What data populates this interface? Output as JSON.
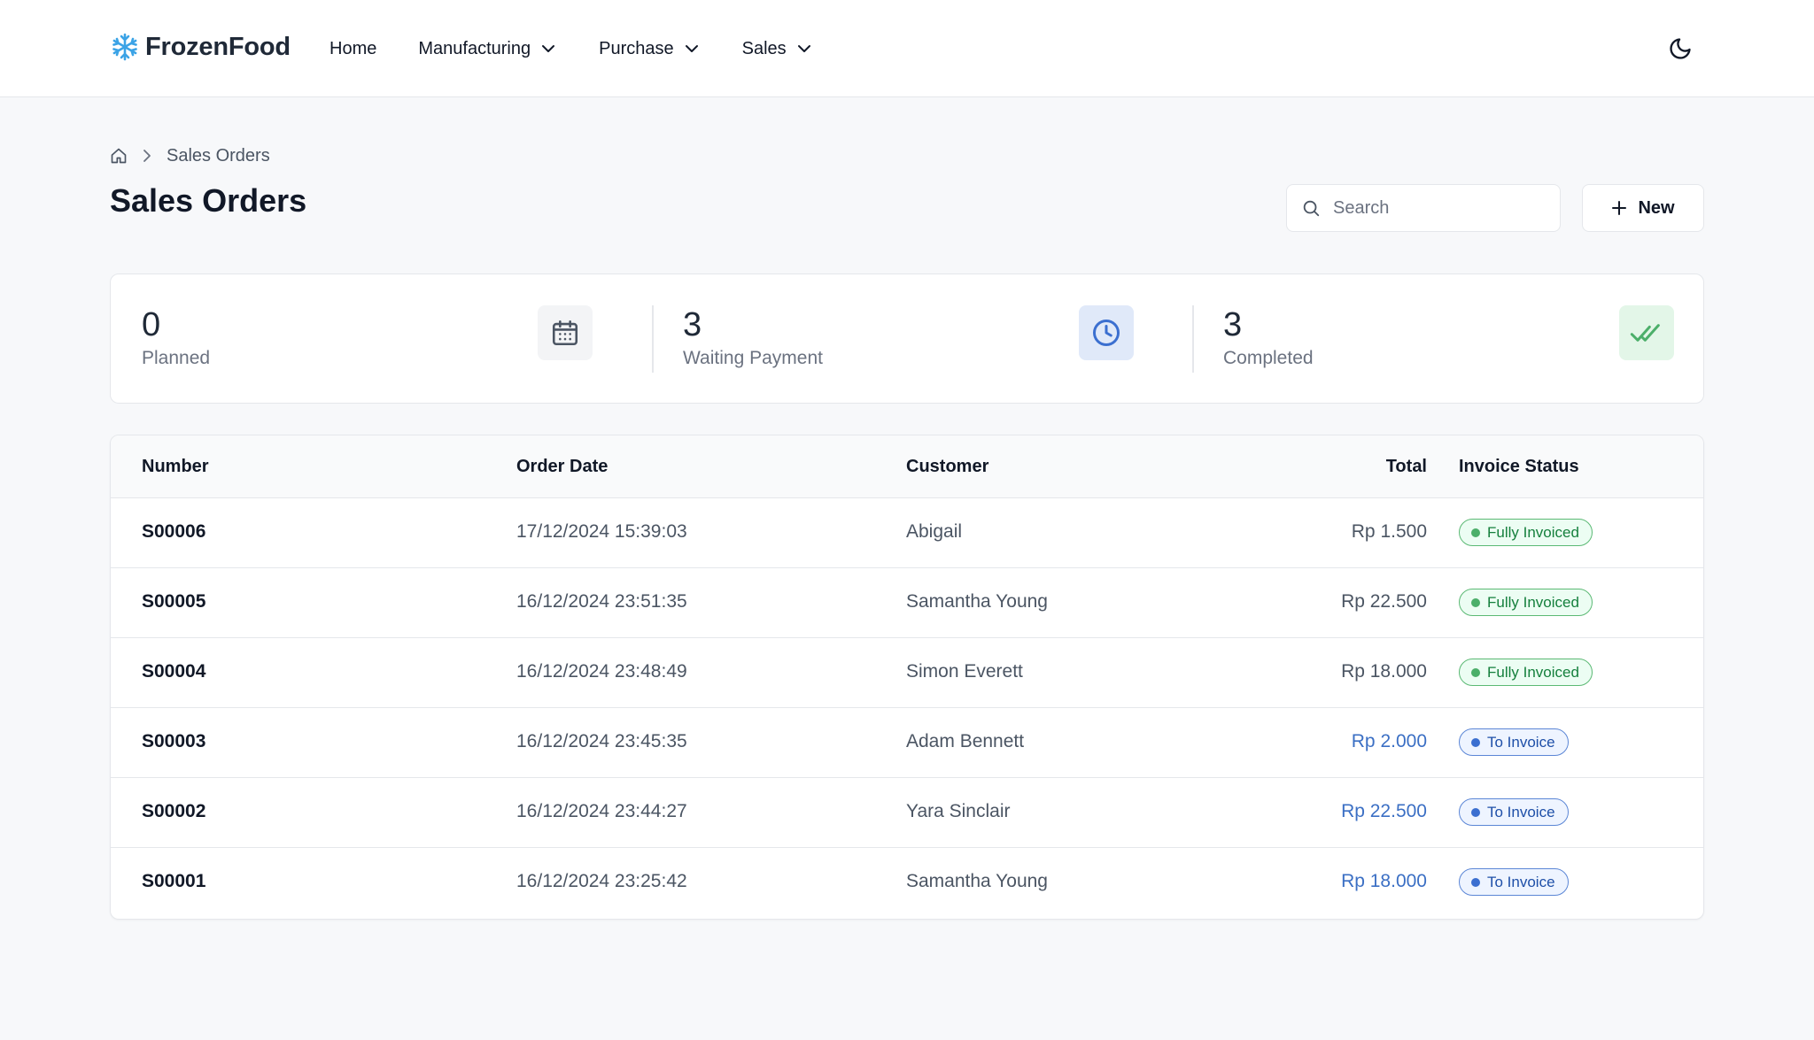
{
  "app": {
    "name": "FrozenFood"
  },
  "nav": {
    "items": [
      {
        "label": "Home",
        "dropdown": false
      },
      {
        "label": "Manufacturing",
        "dropdown": true
      },
      {
        "label": "Purchase",
        "dropdown": true
      },
      {
        "label": "Sales",
        "dropdown": true
      }
    ],
    "theme_toggle_icon": "moon-icon"
  },
  "breadcrumb": {
    "home_icon": "home-icon",
    "current": "Sales Orders"
  },
  "page": {
    "title": "Sales Orders"
  },
  "search": {
    "placeholder": "Search",
    "value": ""
  },
  "actions": {
    "new_label": "New"
  },
  "stats": [
    {
      "value": "0",
      "label": "Planned",
      "icon": "calendar-icon",
      "color": "#6b7280"
    },
    {
      "value": "3",
      "label": "Waiting Payment",
      "icon": "clock-icon",
      "color": "#3b6fd0"
    },
    {
      "value": "3",
      "label": "Completed",
      "icon": "double-check-icon",
      "color": "#4caf6a"
    }
  ],
  "table": {
    "columns": [
      "Number",
      "Order Date",
      "Customer",
      "Total",
      "Invoice Status"
    ],
    "rows": [
      {
        "number": "S00006",
        "date": "17/12/2024 15:39:03",
        "customer": "Abigail",
        "total": "Rp 1.500",
        "status": "Fully Invoiced"
      },
      {
        "number": "S00005",
        "date": "16/12/2024 23:51:35",
        "customer": "Samantha Young",
        "total": "Rp 22.500",
        "status": "Fully Invoiced"
      },
      {
        "number": "S00004",
        "date": "16/12/2024 23:48:49",
        "customer": "Simon Everett",
        "total": "Rp 18.000",
        "status": "Fully Invoiced"
      },
      {
        "number": "S00003",
        "date": "16/12/2024 23:45:35",
        "customer": "Adam Bennett",
        "total": "Rp 2.000",
        "status": "To Invoice"
      },
      {
        "number": "S00002",
        "date": "16/12/2024 23:44:27",
        "customer": "Yara Sinclair",
        "total": "Rp 22.500",
        "status": "To Invoice"
      },
      {
        "number": "S00001",
        "date": "16/12/2024 23:25:42",
        "customer": "Samantha Young",
        "total": "Rp 18.000",
        "status": "To Invoice"
      }
    ]
  },
  "colors": {
    "brand_icon": "#3ba3e6",
    "fully_invoiced": "#4caf6a",
    "to_invoice": "#3b6fd0"
  }
}
